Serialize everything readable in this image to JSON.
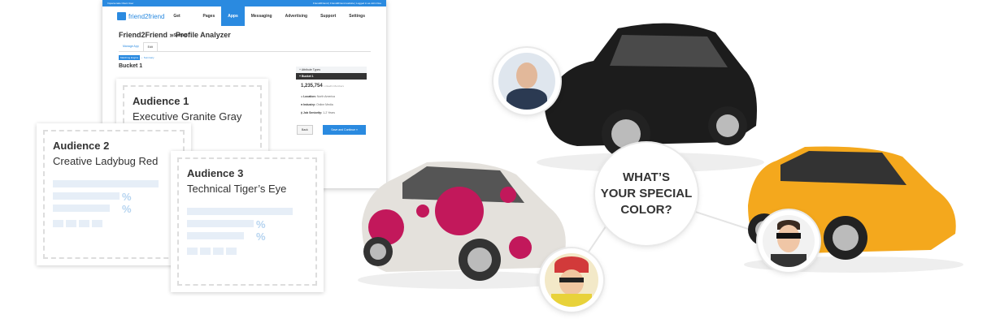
{
  "app": {
    "topbar_left": "Impersonate Client User",
    "topbar_right": "Friend2Friend | Friend2Friend website | Logged in as John Doe",
    "logo": "friend2friend",
    "nav": [
      {
        "label": "Get Started"
      },
      {
        "label": "Pages"
      },
      {
        "label": "Apps",
        "active": true
      },
      {
        "label": "Messaging"
      },
      {
        "label": "Advertising"
      },
      {
        "label": "Support"
      },
      {
        "label": "Settings"
      }
    ],
    "page_title": "Friend2Friend » Profile Analyzer",
    "tabs": [
      "Manage App",
      "Edit"
    ],
    "crumb_active": "Matching Engine",
    "crumb_next": "Summary",
    "bucket_title": "Bucket 1",
    "panel": {
      "header": "+ Attribute Types",
      "bucket": "+ Bucket 1",
      "count": "1,235,754",
      "count_label": "LinkedIn Members",
      "rows": [
        {
          "label": "Location:",
          "value": "North America",
          "icon": "location-pin-icon"
        },
        {
          "label": "Industry:",
          "value": "Online Media",
          "icon": "briefcase-icon"
        },
        {
          "label": "Job Seniority:",
          "value": "1-2 Years",
          "icon": "id-card-icon"
        }
      ],
      "back": "Back",
      "save": "Save and Continue »"
    }
  },
  "audiences": [
    {
      "title": "Audience 1",
      "subtitle": "Executive Granite Gray"
    },
    {
      "title": "Audience 2",
      "subtitle": "Creative Ladybug Red"
    },
    {
      "title": "Audience 3",
      "subtitle": "Technical Tiger’s Eye"
    }
  ],
  "percent_sign": "%",
  "center_text": [
    "WHAT’S",
    "YOUR SPECIAL",
    "COLOR?"
  ],
  "colors": {
    "accent": "#2a8ae0",
    "gray_car": "#1c1c1c",
    "red_spot": "#c2185b",
    "yellow_car": "#f4a81d"
  }
}
